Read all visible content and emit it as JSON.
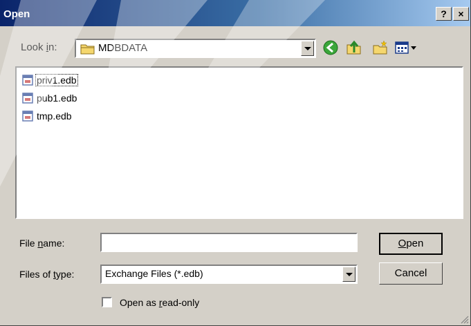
{
  "window": {
    "title": "Open",
    "help_label": "?",
    "close_label": "×"
  },
  "lookin": {
    "label_pre": "Look ",
    "label_key": "i",
    "label_post": "n:",
    "value": "MDBDATA"
  },
  "toolbar": {
    "icons": [
      "back-icon",
      "up-folder-icon",
      "new-folder-icon",
      "views-menu-icon"
    ]
  },
  "files": {
    "items": [
      "priv1.edb",
      "pub1.edb",
      "tmp.edb"
    ],
    "icon": "database-file-icon"
  },
  "filename": {
    "label_pre": "File ",
    "label_key": "n",
    "label_post": "ame:",
    "value": ""
  },
  "filetype": {
    "label_pre": "Files of ",
    "label_key": "t",
    "label_post": "ype:",
    "value": "Exchange Files (*.edb)"
  },
  "buttons": {
    "open_key": "O",
    "open_rest": "pen",
    "cancel": "Cancel"
  },
  "readonly": {
    "label_pre": "Open as ",
    "label_key": "r",
    "label_post": "ead-only",
    "checked": false
  },
  "colors": {
    "titlebar_start": "#0a246a",
    "titlebar_end": "#a6caf0",
    "dialog_face": "#d4d0c8"
  }
}
